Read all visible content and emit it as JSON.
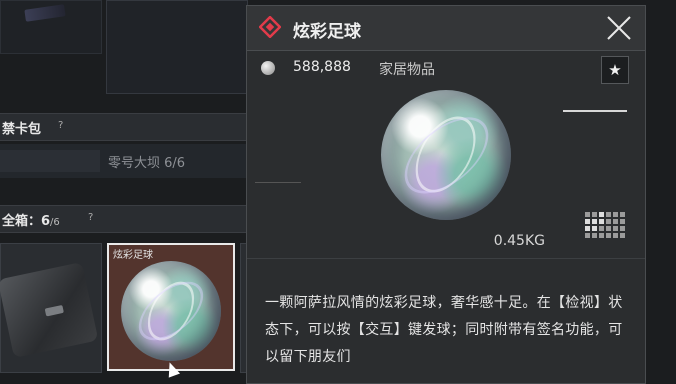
{
  "inventory": {
    "section1": {
      "title": "禁卡包",
      "help": "?"
    },
    "section1_item": {
      "label": "零号大坝 6/6"
    },
    "section2": {
      "title": "全箱：6",
      "count_suffix": "/6",
      "help": "?"
    },
    "slot_item": {
      "label": "炫彩足球"
    }
  },
  "detail": {
    "title": "炫彩足球",
    "price": "588,888",
    "category": "家居物品",
    "weight": "0.45KG",
    "star": "★",
    "description": "一颗阿萨拉风情的炫彩足球，奢华感十足。在【检视】状态下，可以按【交互】键发球；同时附带有签名功能，可以留下朋友们"
  },
  "icons": [
    "diamond-icon",
    "close-icon",
    "coin-icon",
    "star-icon",
    "grid-size-icon",
    "football-icon",
    "case-icon",
    "cursor-icon"
  ],
  "colors": {
    "accent": "#e23b4a",
    "panel": "#2b2d2f",
    "selected_slot": "#53342d"
  }
}
